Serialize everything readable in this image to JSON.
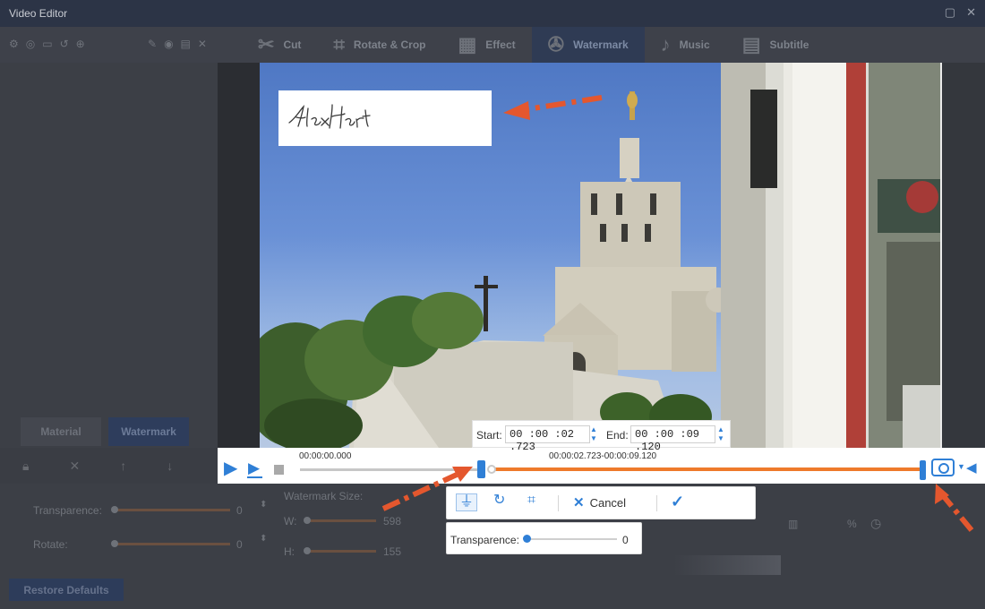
{
  "window": {
    "title": "Video Editor"
  },
  "toolbar": {
    "tabs": [
      {
        "label": "Cut",
        "icon": "scissors-icon"
      },
      {
        "label": "Rotate & Crop",
        "icon": "crop-icon"
      },
      {
        "label": "Effect",
        "icon": "clapper-icon"
      },
      {
        "label": "Watermark",
        "icon": "film-reel-icon",
        "active": true
      },
      {
        "label": "Music",
        "icon": "music-note-icon"
      },
      {
        "label": "Subtitle",
        "icon": "subtitle-icon"
      }
    ]
  },
  "left_panel": {
    "tabs": [
      {
        "label": "Material"
      },
      {
        "label": "Watermark",
        "active": true
      }
    ]
  },
  "settings": {
    "transparence_label": "Transparence:",
    "transparence_value": "0",
    "rotate_label": "Rotate:",
    "rotate_value": "0",
    "watermark_size_label": "Watermark Size:",
    "w_label": "W:",
    "w_value": "598",
    "h_label": "H:",
    "h_value": "155",
    "pct_label": "%",
    "restore_label": "Restore Defaults"
  },
  "watermark": {
    "signature_text": "Alex Hart"
  },
  "playback": {
    "current_time": "00:00:00.000",
    "range_text": "00:00:02.723-00:00:09.120",
    "range_start_fraction": 0.36,
    "range_end_fraction": 1.0
  },
  "range_popup": {
    "start_label": "Start:",
    "start_value": "00 :00 :02 .723",
    "end_label": "End:",
    "end_value": "00 :00 :09 .120"
  },
  "action_popup": {
    "cancel_label": "Cancel"
  },
  "transparence_popup": {
    "label": "Transparence:",
    "value": "0",
    "level": 0
  },
  "colors": {
    "accent": "#2f7fd6",
    "range_track": "#ee7a2b",
    "annotation_arrow": "#e4572e"
  }
}
